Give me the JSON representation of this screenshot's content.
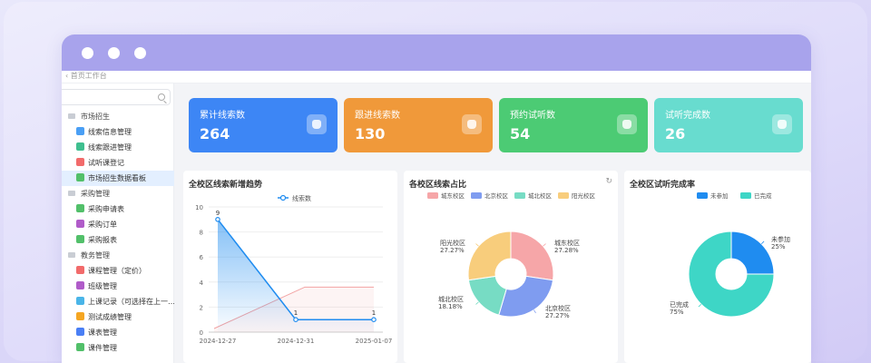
{
  "breadcrumb": "首页工作台",
  "sidebar": {
    "groups": [
      {
        "label": "市场招生",
        "items": [
          {
            "label": "线索信息管理",
            "icon": "lead-info-icon",
            "color": "#4a9ff5"
          },
          {
            "label": "线索跟进管理",
            "icon": "lead-follow-icon",
            "color": "#3fbf8f"
          },
          {
            "label": "试听课登记",
            "icon": "trial-class-icon",
            "color": "#f26b6b"
          },
          {
            "label": "市场招生数据看板",
            "icon": "dashboard-icon",
            "color": "#52c06a",
            "active": true
          }
        ]
      },
      {
        "label": "采购管理",
        "items": [
          {
            "label": "采购申请表",
            "icon": "purchase-request-icon",
            "color": "#52c06a"
          },
          {
            "label": "采购订单",
            "icon": "purchase-order-icon",
            "color": "#b05cc9"
          },
          {
            "label": "采购报表",
            "icon": "purchase-report-icon",
            "color": "#52c06a"
          }
        ]
      },
      {
        "label": "教务管理",
        "items": [
          {
            "label": "课程管理（定价）",
            "icon": "course-icon",
            "color": "#f26b6b"
          },
          {
            "label": "班级管理",
            "icon": "class-icon",
            "color": "#b05cc9"
          },
          {
            "label": "上课记录（可选择在上一…",
            "icon": "attendance-icon",
            "color": "#4ab5e8"
          },
          {
            "label": "测试成绩管理",
            "icon": "test-score-icon",
            "color": "#f5a623"
          },
          {
            "label": "课表管理",
            "icon": "schedule-icon",
            "color": "#4a7ff5"
          },
          {
            "label": "课件管理",
            "icon": "courseware-icon",
            "color": "#52c06a"
          }
        ]
      }
    ]
  },
  "cards": [
    {
      "label": "累计线索数",
      "value": "264",
      "color": "#3d86f5",
      "icon": "leads-total-icon"
    },
    {
      "label": "跟进线索数",
      "value": "130",
      "color": "#f0993a",
      "icon": "leads-followed-icon"
    },
    {
      "label": "预约试听数",
      "value": "54",
      "color": "#4ccb74",
      "icon": "trial-booked-icon"
    },
    {
      "label": "试听完成数",
      "value": "26",
      "color": "#68dccf",
      "icon": "trial-completed-icon"
    }
  ],
  "panels": {
    "trend_title": "全校区线索新增趋势",
    "share_title": "各校区线索占比",
    "completion_title": "全校区试听完成率"
  },
  "chart_data": [
    {
      "type": "line",
      "title": "全校区线索新增趋势",
      "x": [
        "2024-12-27",
        "2024-12-31",
        "2025-01-07"
      ],
      "series": [
        {
          "name": "线索数",
          "values": [
            9,
            1,
            1
          ]
        }
      ],
      "yticks": [
        0,
        2,
        4,
        6,
        8,
        10
      ],
      "ylim": [
        0,
        10
      ],
      "grid": true,
      "legend": "top-center",
      "colors": {
        "line": "#1f8cf0",
        "secondary": "#f2a3a3"
      }
    },
    {
      "type": "pie",
      "title": "各校区线索占比",
      "donut": true,
      "legend": "top",
      "slices": [
        {
          "name": "城东校区",
          "value": 27.28,
          "label": "27.28%",
          "color": "#f6a6a8"
        },
        {
          "name": "北京校区",
          "value": 27.27,
          "label": "27.27%",
          "color": "#7f9cf0"
        },
        {
          "name": "城北校区",
          "value": 18.18,
          "label": "18.18%",
          "color": "#77dcc4"
        },
        {
          "name": "阳光校区",
          "value": 27.27,
          "label": "27.27%",
          "color": "#f8cd7c"
        }
      ]
    },
    {
      "type": "pie",
      "title": "全校区试听完成率",
      "donut": true,
      "legend": "top",
      "slices": [
        {
          "name": "未参加",
          "value": 25,
          "label": "25%",
          "color": "#1f8cf0"
        },
        {
          "name": "已完成",
          "value": 75,
          "label": "75%",
          "color": "#3ed6c6"
        }
      ]
    }
  ]
}
